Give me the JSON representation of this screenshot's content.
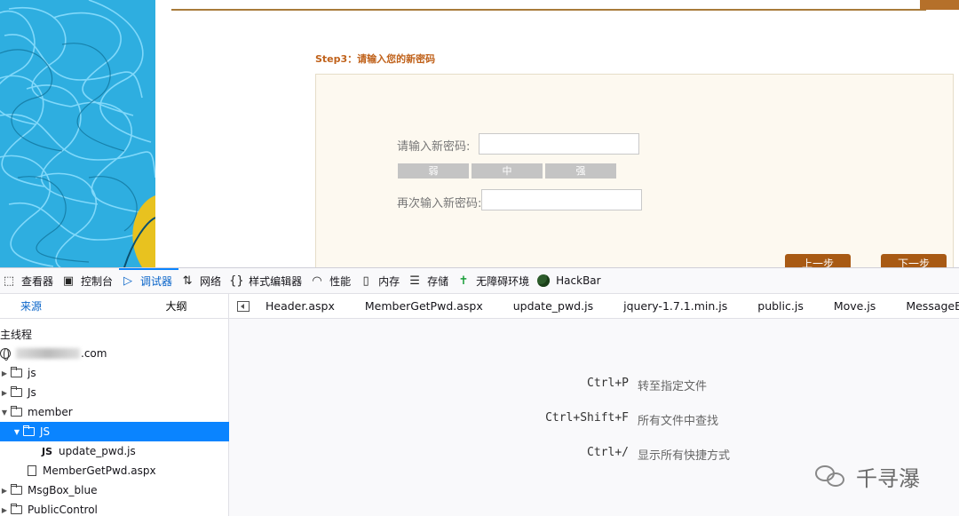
{
  "webpage": {
    "step_title": "Step3：请输入您的新密码",
    "new_password_label": "请输入新密码:",
    "confirm_password_label": "再次输入新密码:",
    "new_password_value": "",
    "confirm_password_value": "",
    "strength": [
      "弱",
      "中",
      "强"
    ],
    "prev_button": "上一步",
    "next_button": "下一步"
  },
  "devtools": {
    "tabs": [
      {
        "label": "查看器",
        "icon": "inspector-icon"
      },
      {
        "label": "控制台",
        "icon": "console-icon"
      },
      {
        "label": "调试器",
        "icon": "debugger-icon",
        "active": true
      },
      {
        "label": "网络",
        "icon": "network-icon"
      },
      {
        "label": "样式编辑器",
        "icon": "style-editor-icon"
      },
      {
        "label": "性能",
        "icon": "performance-icon"
      },
      {
        "label": "内存",
        "icon": "memory-icon"
      },
      {
        "label": "存储",
        "icon": "storage-icon"
      },
      {
        "label": "无障碍环境",
        "icon": "accessibility-icon"
      },
      {
        "label": "HackBar",
        "icon": "hackbar-icon"
      }
    ],
    "left_tabs": {
      "sources": "来源",
      "outline": "大纲"
    },
    "tree": {
      "main_thread": "主线程",
      "domain": ".com",
      "items": [
        "js",
        "Js",
        "member",
        "JS",
        "update_pwd.js",
        "MemberGetPwd.aspx",
        "MsgBox_blue",
        "PublicControl"
      ]
    },
    "file_tabs": [
      "Header.aspx",
      "MemberGetPwd.aspx",
      "update_pwd.js",
      "jquery-1.7.1.min.js",
      "public.js",
      "Move.js",
      "MessageBox_scrolling"
    ],
    "shortcuts": [
      {
        "key": "Ctrl+P",
        "desc": "转至指定文件"
      },
      {
        "key": "Ctrl+Shift+F",
        "desc": "所有文件中查找"
      },
      {
        "key": "Ctrl+/",
        "desc": "显示所有快捷方式"
      }
    ]
  },
  "watermark": "千寻瀑",
  "colors": {
    "accent": "#0a84ff",
    "button": "#a85a14",
    "step_title": "#c0621b"
  }
}
